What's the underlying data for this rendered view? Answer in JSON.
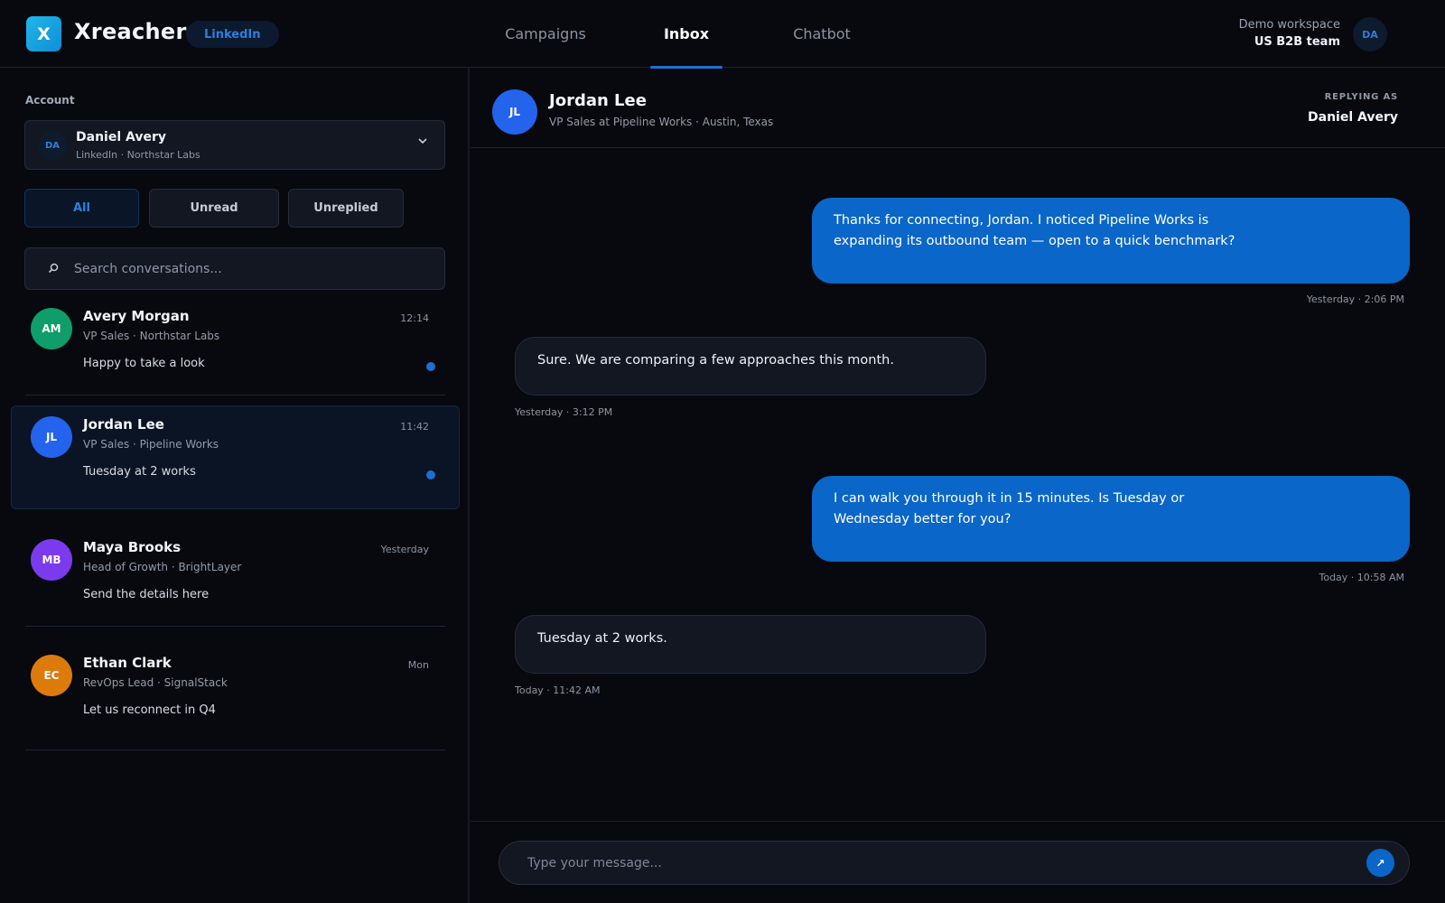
{
  "app": {
    "logo_letter": "X",
    "brand": "Xreacher",
    "channel_badge": "LinkedIn"
  },
  "nav": {
    "tabs": [
      {
        "label": "Campaigns",
        "active": false
      },
      {
        "label": "Inbox",
        "active": true
      },
      {
        "label": "Chatbot",
        "active": false
      }
    ]
  },
  "workspace": {
    "name": "Demo workspace",
    "team": "US B2B team",
    "avatar_initials": "DA"
  },
  "sidebar": {
    "account_label": "Account",
    "account": {
      "initials": "DA",
      "name": "Daniel Avery",
      "sub": "LinkedIn · Northstar Labs"
    },
    "filters": [
      {
        "label": "All",
        "active": true
      },
      {
        "label": "Unread",
        "active": false
      },
      {
        "label": "Unreplied",
        "active": false
      }
    ],
    "search_placeholder": "Search conversations...",
    "conversations": [
      {
        "initials": "AM",
        "name": "Avery Morgan",
        "time": "12:14",
        "sub": "VP Sales · Northstar Labs",
        "preview": "Happy to take a look",
        "unread": true,
        "color": "#0f9d6b"
      },
      {
        "initials": "JL",
        "name": "Jordan Lee",
        "time": "11:42",
        "sub": "VP Sales · Pipeline Works",
        "preview": "Tuesday at 2 works",
        "unread": true,
        "color": "#2463eb",
        "selected": true
      },
      {
        "initials": "MB",
        "name": "Maya Brooks",
        "time": "Yesterday",
        "sub": "Head of Growth · BrightLayer",
        "preview": "Send the details here",
        "unread": false,
        "color": "#7c3aed"
      },
      {
        "initials": "EC",
        "name": "Ethan Clark",
        "time": "Mon",
        "sub": "RevOps Lead · SignalStack",
        "preview": "Let us reconnect in Q4",
        "unread": false,
        "color": "#dd7a0c"
      }
    ]
  },
  "chat": {
    "contact": {
      "initials": "JL",
      "name": "Jordan Lee",
      "sub": "VP Sales at Pipeline Works · Austin, Texas"
    },
    "replying_as_label": "REPLYING AS",
    "replying_as_name": "Daniel Avery",
    "messages": [
      {
        "direction": "out",
        "text": "Thanks for connecting, Jordan. I noticed Pipeline Works is expanding its outbound team — open to a quick benchmark?",
        "time": "Yesterday · 2:06 PM"
      },
      {
        "direction": "in",
        "text": "Sure. We are comparing a few approaches this month.",
        "time": "Yesterday · 3:12 PM"
      },
      {
        "direction": "out",
        "text": "I can walk you through it in 15 minutes. Is Tuesday or Wednesday better for you?",
        "time": "Today · 10:58 AM"
      },
      {
        "direction": "in",
        "text": "Tuesday at 2 works.",
        "time": "Today · 11:42 AM"
      }
    ],
    "composer_placeholder": "Type your message...",
    "send_icon": "↗"
  },
  "colors": {
    "accent": "#0a66c8",
    "background": "#07090f",
    "surface": "#121722"
  }
}
